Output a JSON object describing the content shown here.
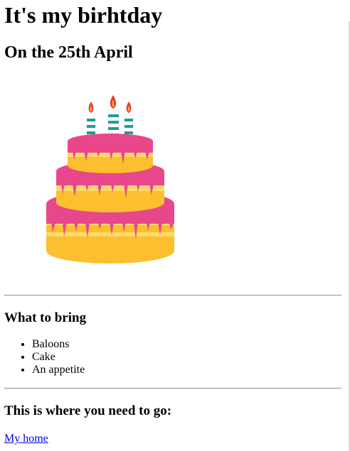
{
  "heading": "It's my birhtday",
  "subheading": "On the 25th April",
  "image": {
    "icon": "birthday-cake-icon",
    "colors": {
      "frosting": "#e8478b",
      "cake": "#fdd96b",
      "cake_dark": "#fcbf2e",
      "candle_stripe": "#1e9e96",
      "flame": "#e63b2e"
    }
  },
  "bring": {
    "title": "What to bring",
    "items": [
      "Baloons",
      "Cake",
      "An appetite"
    ]
  },
  "where": {
    "title": "This is where you need to go:",
    "link_label": "My home"
  }
}
